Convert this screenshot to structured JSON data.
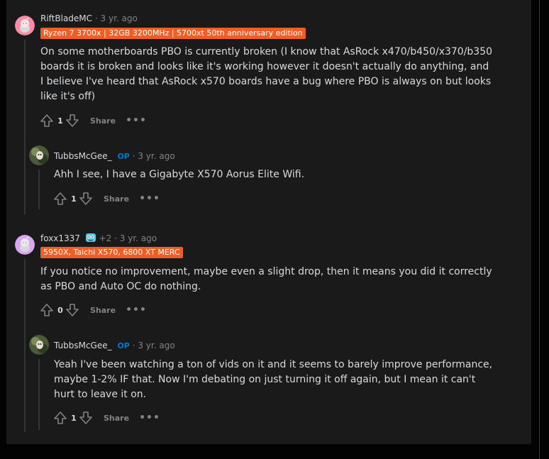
{
  "comments": [
    {
      "username": "RiftBladeMC",
      "time": "3 yr. ago",
      "flair": "Ryzen 7 3700x | 32GB 3200MHz | 5700xt 50th anniversary edition",
      "body": "On some motherboards PBO is currently broken (I know that AsRock x470/b450/x370/b350 boards it is broken and looks like it's working however it doesn't actually do anything, and I believe I've heard that AsRock x570 boards have a bug where PBO is always on but looks like it's off)",
      "score": "1",
      "share_label": "Share",
      "more_label": "•••",
      "avatar_color": "#ff8aa5"
    },
    {
      "username": "TubbsMcGee_",
      "op_label": "OP",
      "time": "3 yr. ago",
      "body": "Ahh I see, I have a Gigabyte X570 Aorus Elite Wifi.",
      "score": "1",
      "share_label": "Share",
      "more_label": "•••"
    },
    {
      "username": "foxx1337",
      "award_count": "+2",
      "time": "3 yr. ago",
      "flair": "5950X, Taichi X570, 6800 XT MERC",
      "body": "If you notice no improvement, maybe even a slight drop, then it means you did it correctly as PBO and Auto OC do nothing.",
      "score": "0",
      "share_label": "Share",
      "more_label": "•••",
      "avatar_color": "#d9a6f2"
    },
    {
      "username": "TubbsMcGee_",
      "op_label": "OP",
      "time": "3 yr. ago",
      "body": "Yeah I've been watching a ton of vids on it and it seems to barely improve performance, maybe 1-2% IF that. Now I'm debating on just turning it off again, but I mean it can't hurt to leave it on.",
      "score": "1",
      "share_label": "Share",
      "more_label": "•••"
    }
  ],
  "meta_separator": "·",
  "colors": {
    "background": "#1a1a1b",
    "flair": "#f05e23",
    "op": "#0079d3",
    "text": "#d7dadc",
    "muted": "#818384"
  }
}
